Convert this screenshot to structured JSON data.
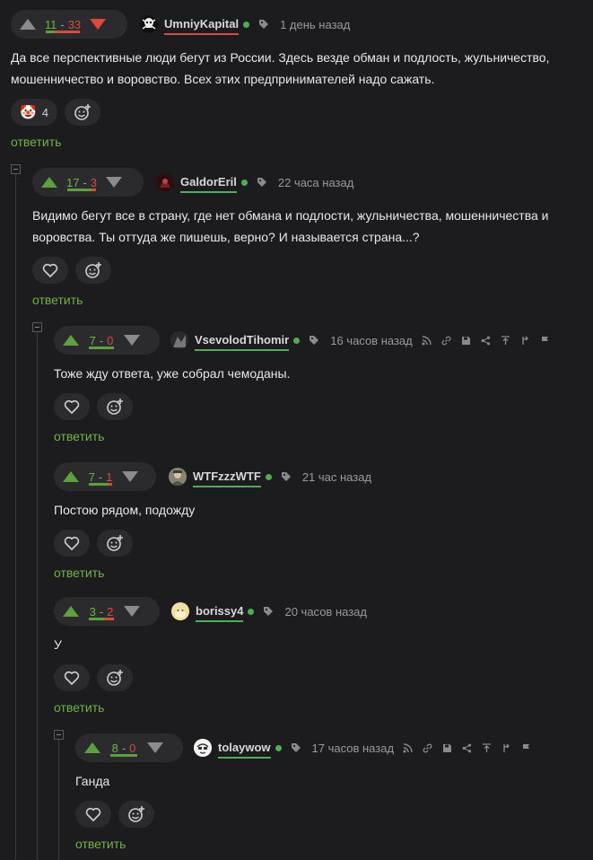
{
  "comments": [
    {
      "plus": "11",
      "minus": "33",
      "username": "UmniyKapital",
      "time": "1 день назад",
      "text": "Да все перспективные люди бегут из России. Здесь везде обман и подлость, жульничество, мошенничество и воровство. Всех этих предпринимателей надо сажать.",
      "reaction_emoji": "🤡",
      "reaction_count": "4",
      "reply_label": "ответить"
    },
    {
      "plus": "17",
      "minus": "3",
      "username": "GaldorEril",
      "time": "22 часа назад",
      "text": "Видимо бегут все в страну, где нет обмана и подлости, жульничества, мошенничества и воровства. Ты оттуда же пишешь, верно? И называется страна...?",
      "reply_label": "ответить"
    },
    {
      "plus": "7",
      "minus": "0",
      "username": "VsevolodTihomir",
      "time": "16 часов назад",
      "text": "Тоже жду ответа, уже собрал чемоданы.",
      "reply_label": "ответить"
    },
    {
      "plus": "7",
      "minus": "1",
      "username": "WTFzzzWTF",
      "time": "21 час назад",
      "text": "Постою рядом, подожду",
      "reply_label": "ответить"
    },
    {
      "plus": "3",
      "minus": "2",
      "username": "borissy4",
      "time": "20 часов назад",
      "text": "У",
      "reply_label": "ответить"
    },
    {
      "plus": "8",
      "minus": "0",
      "username": "tolaywow",
      "time": "17 часов назад",
      "text": "Ганда",
      "reply_label": "ответить"
    }
  ],
  "colors": {
    "background": "#1c1c1e",
    "accent_green": "#6cb545",
    "negative_red": "#e0483c",
    "online_dot": "#4caf50"
  }
}
